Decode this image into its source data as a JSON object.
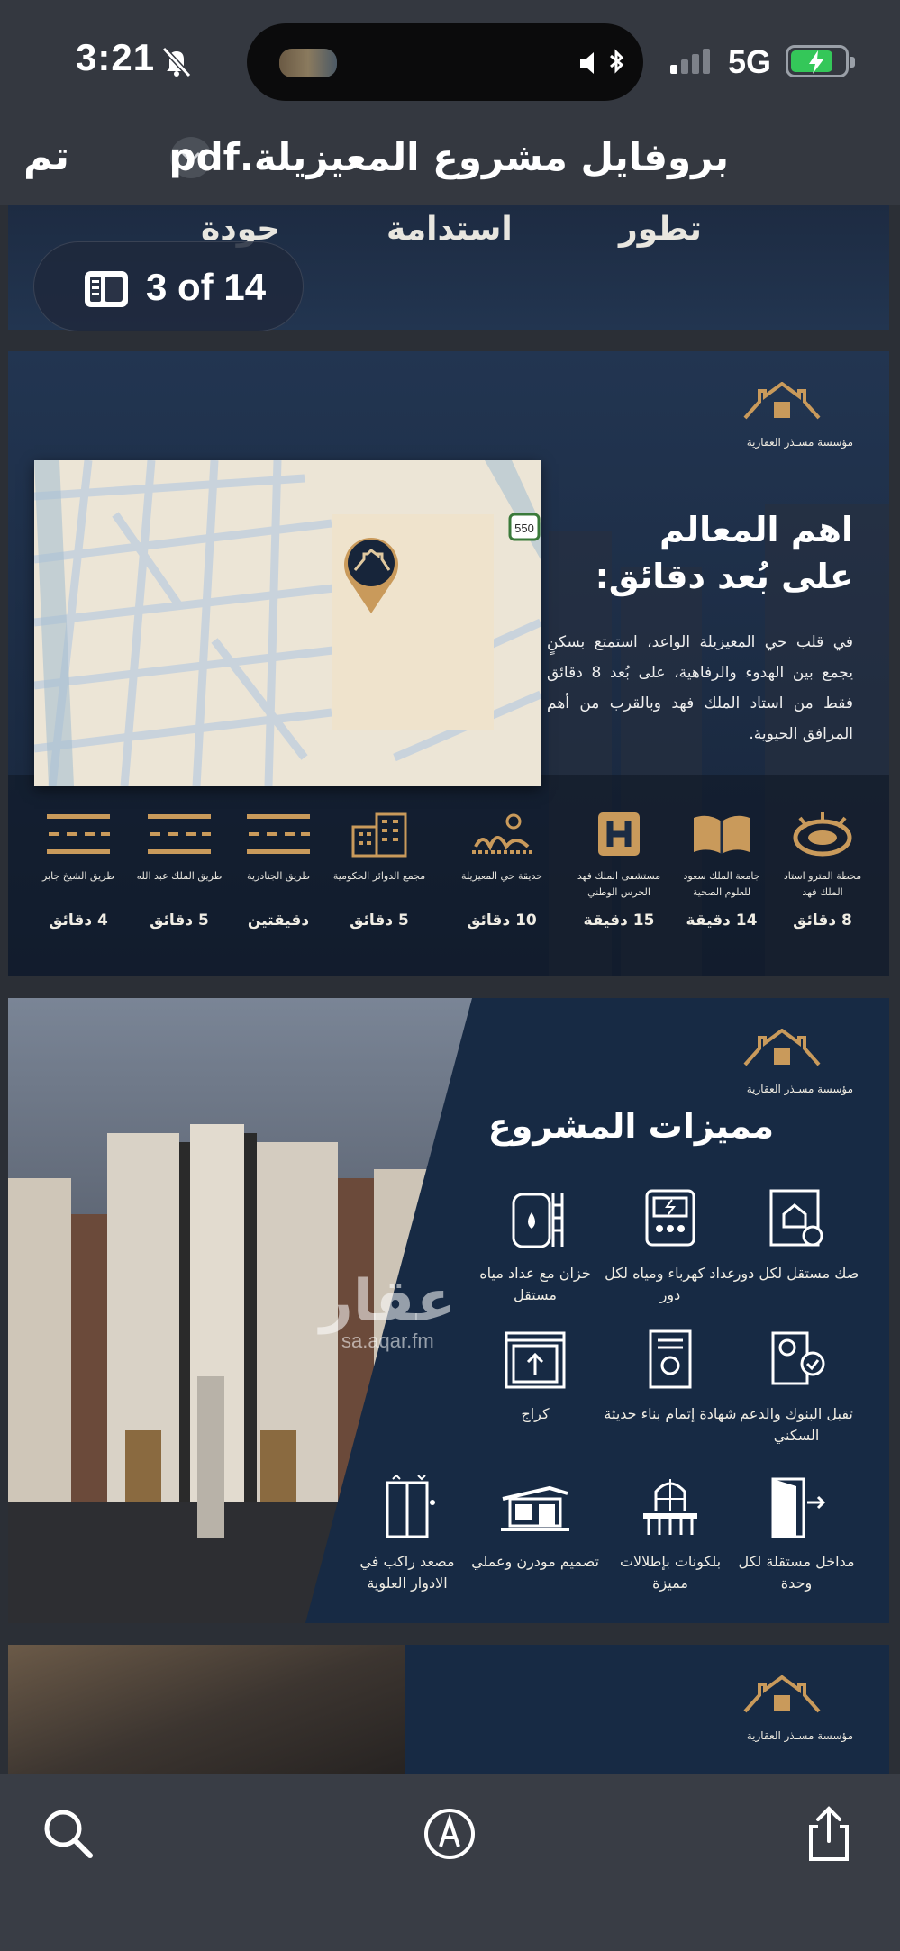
{
  "status_bar": {
    "time": "3:21",
    "network": "5G",
    "battery_level": 0.8
  },
  "nav": {
    "done_label": "تم",
    "title": "بروفايل مشروع المعيزيلة.pdf"
  },
  "page_indicator": {
    "label": "3 of 14"
  },
  "page1": {
    "words": [
      "تطور",
      "استدامة",
      "حودة"
    ]
  },
  "company_logo": {
    "name": "مؤسسة مسـذر العقارية"
  },
  "page2": {
    "heading_line1": "اهم المعالم",
    "heading_line2": "على بُعد دقائق:",
    "paragraph": "في قلب حي المعيزيلة الواعد، استمتع بسكنٍ يجمع بين الهدوء والرفاهية، على بُعد 8 دقائق فقط من استاد الملك فهد وبالقرب من أهم المرافق الحيوية.",
    "map_road_badge": "550",
    "landmarks": [
      {
        "name": "محطة المترو استاد الملك فهد",
        "time": "8 دقائق",
        "icon": "stadium-icon"
      },
      {
        "name": "جامعة الملك سعود للعلوم الصحية",
        "time": "14 دقيقة",
        "icon": "book-icon"
      },
      {
        "name": "مستشفى الملك فهد الحرس الوطني",
        "time": "15 دقيقة",
        "icon": "hospital-icon"
      },
      {
        "name": "حديقة حي المعيزيلة",
        "time": "10 دقائق",
        "icon": "park-icon"
      },
      {
        "name": "مجمع الدوائر الحكومية",
        "time": "5 دقائق",
        "icon": "government-building-icon"
      },
      {
        "name": "طريق الجنادرية",
        "time": "دقيقتين",
        "icon": "road-icon"
      },
      {
        "name": "طريق الملك عبد الله",
        "time": "5 دقائق",
        "icon": "road-icon"
      },
      {
        "name": "طريق الشيخ جابر",
        "time": "4 دقائق",
        "icon": "road-icon"
      }
    ]
  },
  "page3": {
    "heading": "مميزات المشروع",
    "watermark_ar": "عقار",
    "watermark_url": "sa.aqar.fm",
    "features": [
      {
        "label": "صك مستقل لكل دور",
        "icon": "deed-certificate-icon"
      },
      {
        "label": "عداد كهرباء ومياه لكل دور",
        "icon": "electric-meter-icon"
      },
      {
        "label": "خزان مع عداد مياه مستقل",
        "icon": "water-tank-icon"
      },
      {
        "label": "تقبل البنوك والدعم السكني",
        "icon": "bank-document-icon"
      },
      {
        "label": "شهادة إتمام بناء حديثة",
        "icon": "certificate-icon"
      },
      {
        "label": "كراج",
        "icon": "garage-icon"
      },
      {
        "label": "مداخل مستقلة لكل وحدة",
        "icon": "door-entrance-icon"
      },
      {
        "label": "بلكونات بإطلالات مميزة",
        "icon": "balcony-icon"
      },
      {
        "label": "تصميم مودرن وعملي",
        "icon": "modern-house-icon"
      },
      {
        "label": "مصعد راكب في الادوار العلوية",
        "icon": "elevator-icon"
      }
    ]
  },
  "colors": {
    "gold": "#c99a5b",
    "navy": "#172a44",
    "battery_green": "#34c759"
  }
}
